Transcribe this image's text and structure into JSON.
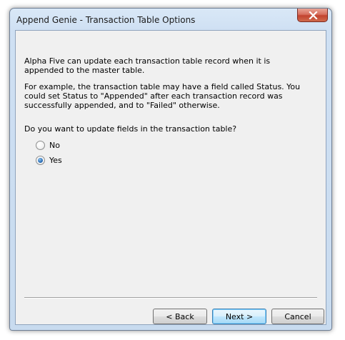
{
  "window": {
    "title": "Append Genie - Transaction Table Options"
  },
  "content": {
    "paragraph1": "Alpha Five can update each transaction table record when it is appended to the master table.",
    "paragraph2": "For example, the transaction table may have a field called Status. You could set Status to \"Appended\" after each transaction record was successfully appended, and to \"Failed\" otherwise.",
    "question": "Do you want to update fields in the transaction table?"
  },
  "options": {
    "no_label": "No",
    "yes_label": "Yes",
    "selected": "Yes"
  },
  "buttons": {
    "back": "< Back",
    "next": "Next >",
    "cancel": "Cancel"
  },
  "colors": {
    "title_bar": "#cfe0f3",
    "close_button": "#c2432f",
    "client_background": "#f0f0f0",
    "default_button_accent": "#3c7fb1"
  }
}
